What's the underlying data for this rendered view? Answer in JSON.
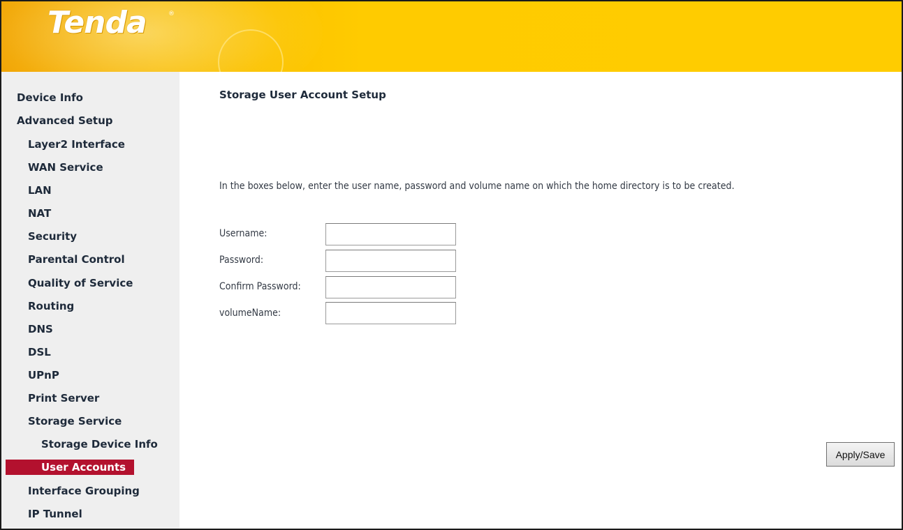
{
  "brand": {
    "logo": "Tenda",
    "registered_mark": "®"
  },
  "sidebar": {
    "items": [
      {
        "label": "Device Info",
        "level": 0,
        "selected": false
      },
      {
        "label": "Advanced Setup",
        "level": 0,
        "selected": false
      },
      {
        "label": "Layer2 Interface",
        "level": 1,
        "selected": false
      },
      {
        "label": "WAN Service",
        "level": 1,
        "selected": false
      },
      {
        "label": "LAN",
        "level": 1,
        "selected": false
      },
      {
        "label": "NAT",
        "level": 1,
        "selected": false
      },
      {
        "label": "Security",
        "level": 1,
        "selected": false
      },
      {
        "label": "Parental Control",
        "level": 1,
        "selected": false
      },
      {
        "label": "Quality of Service",
        "level": 1,
        "selected": false
      },
      {
        "label": "Routing",
        "level": 1,
        "selected": false
      },
      {
        "label": "DNS",
        "level": 1,
        "selected": false
      },
      {
        "label": "DSL",
        "level": 1,
        "selected": false
      },
      {
        "label": "UPnP",
        "level": 1,
        "selected": false
      },
      {
        "label": "Print Server",
        "level": 1,
        "selected": false
      },
      {
        "label": "Storage Service",
        "level": 1,
        "selected": false
      },
      {
        "label": "Storage Device Info",
        "level": 2,
        "selected": false
      },
      {
        "label": "User Accounts",
        "level": 2,
        "selected": true
      },
      {
        "label": "Interface Grouping",
        "level": 1,
        "selected": false
      },
      {
        "label": "IP Tunnel",
        "level": 1,
        "selected": false
      }
    ]
  },
  "main": {
    "title": "Storage User Account Setup",
    "instructions": "In the boxes below, enter the user name, password and volume name on which the home directory is to be created.",
    "fields": [
      {
        "label": "Username:",
        "value": ""
      },
      {
        "label": "Password:",
        "value": ""
      },
      {
        "label": "Confirm Password:",
        "value": ""
      },
      {
        "label": "volumeName:",
        "value": ""
      }
    ],
    "apply_label": "Apply/Save"
  },
  "colors": {
    "header": "#ffcc00",
    "sidebar_bg": "#efefef",
    "selected_bg": "#b3112e",
    "nav_text": "#1e2a3a"
  }
}
